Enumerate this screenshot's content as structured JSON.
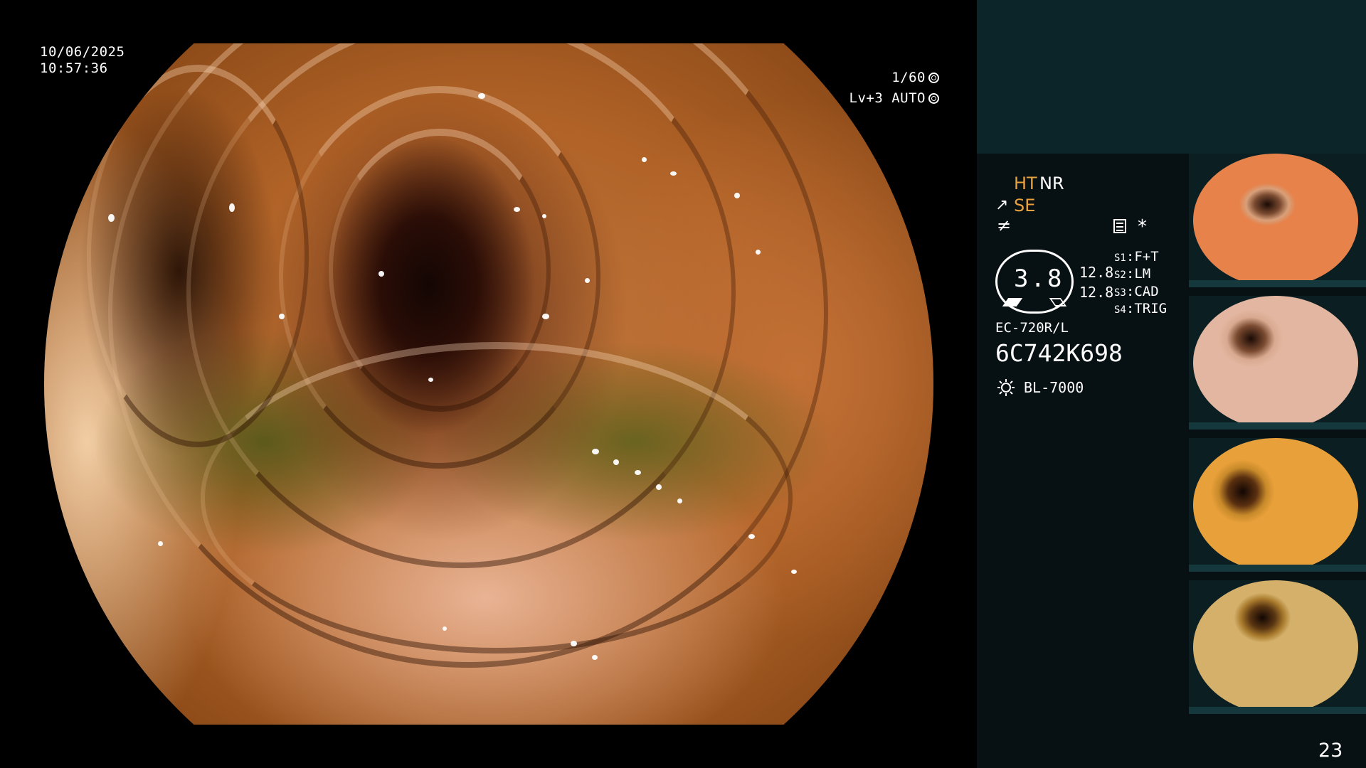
{
  "overlay": {
    "date": "10/06/2025",
    "time": "10:57:36",
    "shutter": "1/60",
    "level": "Lv+3 AUTO"
  },
  "panel": {
    "ht": "HT",
    "nr": "NR",
    "se": "SE",
    "asterisk": "*",
    "gauge_value": "3.8",
    "value_a": "12.8",
    "value_b": "12.8",
    "slots": [
      {
        "key": "S1",
        "value": "F+T"
      },
      {
        "key": "S2",
        "value": "LM"
      },
      {
        "key": "S3",
        "value": "CAD"
      },
      {
        "key": "S4",
        "value": "TRIG"
      }
    ],
    "scope_model": "EC-720R/L",
    "serial": "6C742K698",
    "light_source": "BL-7000",
    "page_number": "23"
  },
  "colors": {
    "panel_bg": "#071013",
    "panel_top_bg": "#0c2529",
    "accent": "#e8a13c"
  }
}
